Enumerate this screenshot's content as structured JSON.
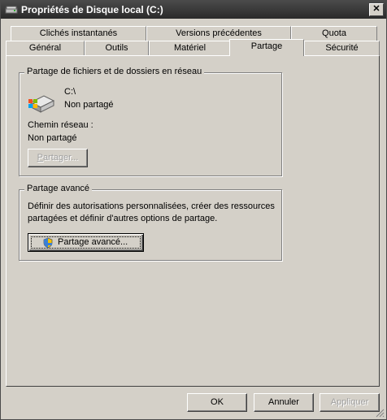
{
  "window": {
    "title": "Propriétés de Disque local (C:)",
    "close_glyph": "✕"
  },
  "tabs_row1": [
    {
      "label": "Clichés instantanés"
    },
    {
      "label": "Versions précédentes"
    },
    {
      "label": "Quota"
    }
  ],
  "tabs_row2": [
    {
      "label": "Général"
    },
    {
      "label": "Outils"
    },
    {
      "label": "Matériel"
    },
    {
      "label": "Partage",
      "active": true
    },
    {
      "label": "Sécurité"
    }
  ],
  "network_sharing": {
    "legend": "Partage de fichiers et de dossiers en réseau",
    "drive_name": "C:\\",
    "status": "Non partagé",
    "network_path_label": "Chemin réseau :",
    "network_path_value": "Non partagé",
    "share_button": {
      "prefix": "P",
      "rest": "artager...",
      "enabled": false
    }
  },
  "advanced_sharing": {
    "legend": "Partage avancé",
    "description_line1": "Définir des autorisations personnalisées, créer des ressources",
    "description_line2": "partagées et définir d'autres options de partage.",
    "button_label": "Partage avancé..."
  },
  "footer": {
    "ok_label": "OK",
    "cancel_label": "Annuler",
    "apply_label": "Appliquer",
    "apply_enabled": false
  },
  "colors": {
    "face": "#d4d0c8",
    "titlebar": "#2e2e2e",
    "disabled_text": "#a0a0a0"
  }
}
